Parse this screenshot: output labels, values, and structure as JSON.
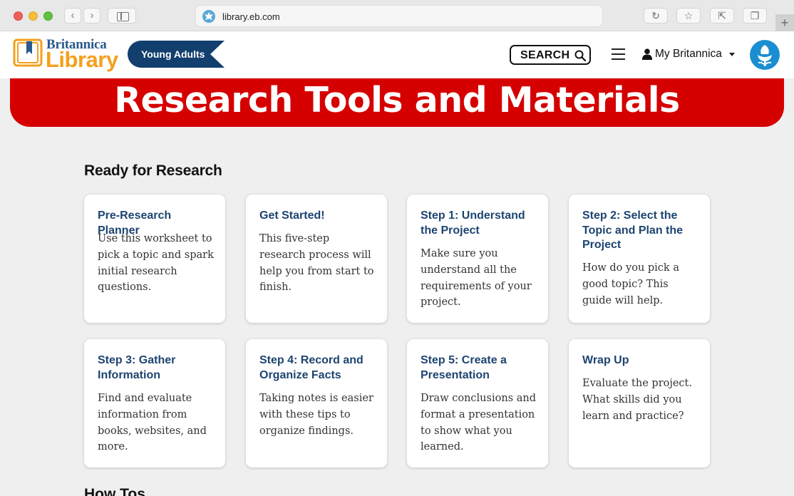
{
  "browser": {
    "url": "library.eb.com"
  },
  "header": {
    "logo_top": "Britannica",
    "logo_bottom": "Library",
    "badge": "Young Adults",
    "search_label": "SEARCH",
    "account_label": "My Britannica"
  },
  "hero": {
    "title": "Research Tools and Materials"
  },
  "section": {
    "title": "Ready for Research",
    "cards": [
      {
        "title": "Pre-Research Planner",
        "desc": "Use this worksheet to pick a topic and spark initial research questions."
      },
      {
        "title": "Get Started!",
        "desc": "This five-step research process will help you from start to finish."
      },
      {
        "title": "Step 1: Understand the Project",
        "desc": "Make sure you understand all the requirements of your project."
      },
      {
        "title": "Step 2: Select the Topic and Plan the Project",
        "desc": "How do you pick a good topic? This guide will help."
      },
      {
        "title": "Step 3: Gather Information",
        "desc": "Find and evaluate information from books, websites, and more."
      },
      {
        "title": "Step 4: Record and Organize Facts",
        "desc": "Taking notes is easier with these tips to organize findings."
      },
      {
        "title": "Step 5: Create a Presentation",
        "desc": "Draw conclusions and format a presentation to show what you learned."
      },
      {
        "title": "Wrap Up",
        "desc": "Evaluate the project. What skills did you learn and practice?"
      }
    ]
  },
  "next_section": {
    "title": "How Tos"
  },
  "colors": {
    "hero_red": "#d50000",
    "card_title_blue": "#1d4470",
    "logo_orange": "#f4a01e",
    "badge_navy": "#123f6e"
  }
}
